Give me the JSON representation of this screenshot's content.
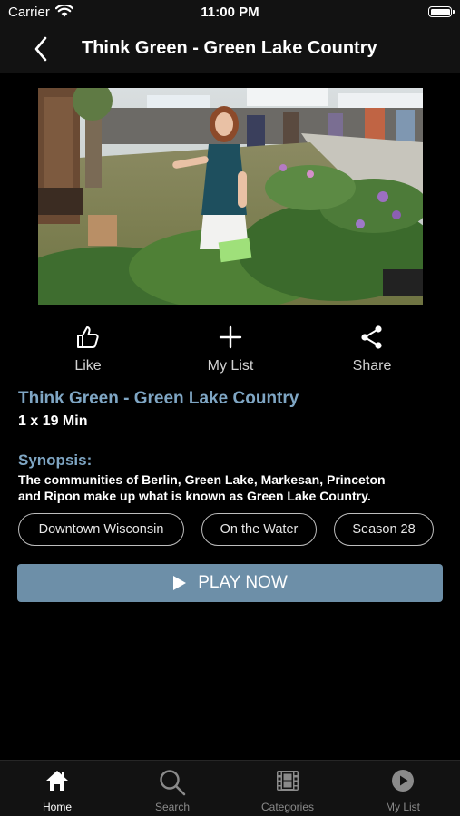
{
  "status_bar": {
    "carrier": "Carrier",
    "time": "11:00 PM"
  },
  "nav": {
    "title": "Think Green - Green Lake Country",
    "back_icon": "chevron-left-icon"
  },
  "video": {
    "thumbnail_description": ""
  },
  "actions": [
    {
      "label": "Like",
      "icon": "thumbs-up-icon"
    },
    {
      "label": "My List",
      "icon": "plus-icon"
    },
    {
      "label": "Share",
      "icon": "share-icon"
    }
  ],
  "details": {
    "title": "Think Green - Green Lake Country",
    "duration": "1 x 19 Min",
    "synopsis_heading": "Synopsis:",
    "synopsis_line1": "The communities of Berlin, Green Lake, Markesan, Princeton",
    "synopsis_line2": "and Ripon make up what is known as Green Lake Country."
  },
  "tags": [
    "Downtown Wisconsin",
    "On the Water",
    "Season 28"
  ],
  "play_button": {
    "label": "PLAY NOW"
  },
  "tab_bar": [
    {
      "label": "Home",
      "icon": "home-icon",
      "active": true
    },
    {
      "label": "Search",
      "icon": "search-icon",
      "active": false
    },
    {
      "label": "Categories",
      "icon": "film-icon",
      "active": false
    },
    {
      "label": "My List",
      "icon": "play-circle-icon",
      "active": false
    }
  ],
  "colors": {
    "accent": "#7fa6c4",
    "play_button": "#6d8fa8",
    "background": "#000000",
    "bar": "#121212"
  }
}
